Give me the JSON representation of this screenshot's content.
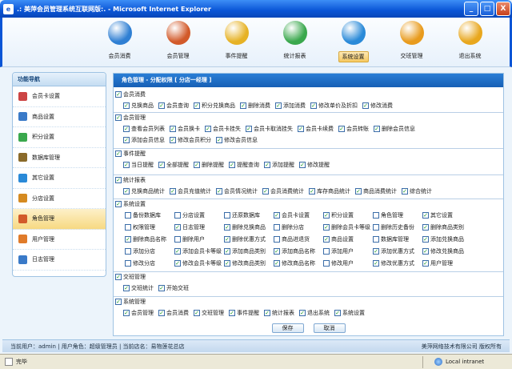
{
  "window": {
    "title": ".: 美萍会员管理系统互联网版:. - Microsoft Internet Explorer",
    "min": "_",
    "max": "□",
    "close": "X"
  },
  "topnav": [
    {
      "label": "会员消费",
      "icon": "member-spend-icon",
      "color": "#2f7fd3"
    },
    {
      "label": "会员管理",
      "icon": "member-manage-icon",
      "color": "#d25a2a"
    },
    {
      "label": "事件提醒",
      "icon": "bubble-icon",
      "color": "#e6b225"
    },
    {
      "label": "统计报表",
      "icon": "chart-pie-icon",
      "color": "#3aa84d"
    },
    {
      "label": "系统设置",
      "icon": "globe-settings-icon",
      "color": "#2a8ad8",
      "active": true
    },
    {
      "label": "交班管理",
      "icon": "refresh-icon",
      "color": "#e89b1d"
    },
    {
      "label": "退出系统",
      "icon": "power-icon",
      "color": "#e8a71e"
    }
  ],
  "sidebar": {
    "title": "功能导航",
    "items": [
      {
        "label": "会员卡设置",
        "color": "#c44"
      },
      {
        "label": "商品设置",
        "color": "#3a7ac8"
      },
      {
        "label": "积分设置",
        "color": "#3aa84d"
      },
      {
        "label": "数据库管理",
        "color": "#8a6a2a"
      },
      {
        "label": "其它设置",
        "color": "#2a8ad8"
      },
      {
        "label": "分店设置",
        "color": "#d58a20"
      },
      {
        "label": "角色管理",
        "color": "#d25a2a",
        "active": true
      },
      {
        "label": "用户管理",
        "color": "#e07b2a"
      },
      {
        "label": "日志管理",
        "color": "#3a7ac8"
      }
    ]
  },
  "main": {
    "header": "角色管理 - 分配权限 [ 分店一经理 ]",
    "sections": [
      {
        "title": "会员消费",
        "checked": true,
        "rows": [
          [
            {
              "l": "兑换商品",
              "c": true
            },
            {
              "l": "会员查询",
              "c": true
            },
            {
              "l": "积分兑换商品",
              "c": true
            },
            {
              "l": "删除消费",
              "c": true
            },
            {
              "l": "添加消费",
              "c": true
            },
            {
              "l": "修改单价及折扣",
              "c": true
            },
            {
              "l": "修改消费",
              "c": true
            }
          ]
        ]
      },
      {
        "title": "会员管理",
        "checked": true,
        "rows": [
          [
            {
              "l": "查看会员列表",
              "c": true
            },
            {
              "l": "会员换卡",
              "c": true
            },
            {
              "l": "会员卡挂失",
              "c": true
            },
            {
              "l": "会员卡取消挂失",
              "c": true
            },
            {
              "l": "会员卡续费",
              "c": true
            },
            {
              "l": "会员转账",
              "c": true
            },
            {
              "l": "删除会员信息",
              "c": true
            }
          ],
          [
            {
              "l": "添加会员信息",
              "c": true
            },
            {
              "l": "修改会员积分",
              "c": true
            },
            {
              "l": "修改会员信息",
              "c": true
            }
          ]
        ]
      },
      {
        "title": "事件提醒",
        "checked": true,
        "rows": [
          [
            {
              "l": "当日提醒",
              "c": true
            },
            {
              "l": "全部提醒",
              "c": true
            },
            {
              "l": "删除提醒",
              "c": true
            },
            {
              "l": "提醒查询",
              "c": true
            },
            {
              "l": "添加提醒",
              "c": true
            },
            {
              "l": "修改提醒",
              "c": true
            }
          ]
        ]
      },
      {
        "title": "统计报表",
        "checked": true,
        "rows": [
          [
            {
              "l": "兑换商品统计",
              "c": true
            },
            {
              "l": "会员充值统计",
              "c": true
            },
            {
              "l": "会员情况统计",
              "c": true
            },
            {
              "l": "会员消费统计",
              "c": true
            },
            {
              "l": "库存商品统计",
              "c": true
            },
            {
              "l": "商品消费统计",
              "c": true
            },
            {
              "l": "综合统计",
              "c": true
            }
          ]
        ]
      },
      {
        "title": "系统设置",
        "checked": true,
        "grid": [
          [
            {
              "l": "备份数据库",
              "c": false
            },
            {
              "l": "分店设置",
              "c": false
            },
            {
              "l": "还原数据库",
              "c": false
            },
            {
              "l": "会员卡设置",
              "c": true
            },
            {
              "l": "积分设置",
              "c": true
            },
            {
              "l": "角色管理",
              "c": false
            },
            {
              "l": "其它设置",
              "c": true
            }
          ],
          [
            {
              "l": "权限管理",
              "c": false
            },
            {
              "l": "日志管理",
              "c": true
            },
            {
              "l": "删除兑换商品",
              "c": true
            },
            {
              "l": "删除分店",
              "c": false
            },
            {
              "l": "删除会员卡等级",
              "c": true
            },
            {
              "l": "删除历史备份",
              "c": false
            },
            {
              "l": "删除商品类别",
              "c": true
            }
          ],
          [
            {
              "l": "删除商品名称",
              "c": true
            },
            {
              "l": "删除用户",
              "c": false
            },
            {
              "l": "删除优惠方式",
              "c": true
            },
            {
              "l": "商品进退货",
              "c": false
            },
            {
              "l": "商品设置",
              "c": true
            },
            {
              "l": "数据库管理",
              "c": false
            },
            {
              "l": "添加兑换商品",
              "c": true
            }
          ],
          [
            {
              "l": "添加分店",
              "c": false
            },
            {
              "l": "添加会员卡等级",
              "c": true
            },
            {
              "l": "添加商品类别",
              "c": true
            },
            {
              "l": "添加商品名称",
              "c": true
            },
            {
              "l": "添加用户",
              "c": false
            },
            {
              "l": "添加优惠方式",
              "c": true
            },
            {
              "l": "修改兑换商品",
              "c": true
            }
          ],
          [
            {
              "l": "修改分店",
              "c": false
            },
            {
              "l": "修改会员卡等级",
              "c": true
            },
            {
              "l": "修改商品类别",
              "c": true
            },
            {
              "l": "修改商品名称",
              "c": true
            },
            {
              "l": "修改用户",
              "c": false
            },
            {
              "l": "修改优惠方式",
              "c": true
            },
            {
              "l": "用户管理",
              "c": true
            }
          ]
        ]
      },
      {
        "title": "交班管理",
        "checked": true,
        "rows": [
          [
            {
              "l": "交班统计",
              "c": true
            },
            {
              "l": "开始交班",
              "c": true
            }
          ]
        ]
      },
      {
        "title": "系统管理",
        "checked": true,
        "rows": [
          [
            {
              "l": "会员管理",
              "c": true
            },
            {
              "l": "会员消费",
              "c": true
            },
            {
              "l": "交班管理",
              "c": true
            },
            {
              "l": "事件提醒",
              "c": true
            },
            {
              "l": "统计报表",
              "c": true
            },
            {
              "l": "退出系统",
              "c": true
            },
            {
              "l": "系统设置",
              "c": true
            }
          ]
        ]
      }
    ],
    "save": "保存",
    "cancel": "取消"
  },
  "footer": {
    "left": "当前用户：admin  |  用户角色：超级管理员  |  当前店名：易物莲花总店",
    "right": "美萍网络技术有限公司 版权所有"
  },
  "statusbar": {
    "left": "完毕",
    "zone": "Local intranet"
  }
}
